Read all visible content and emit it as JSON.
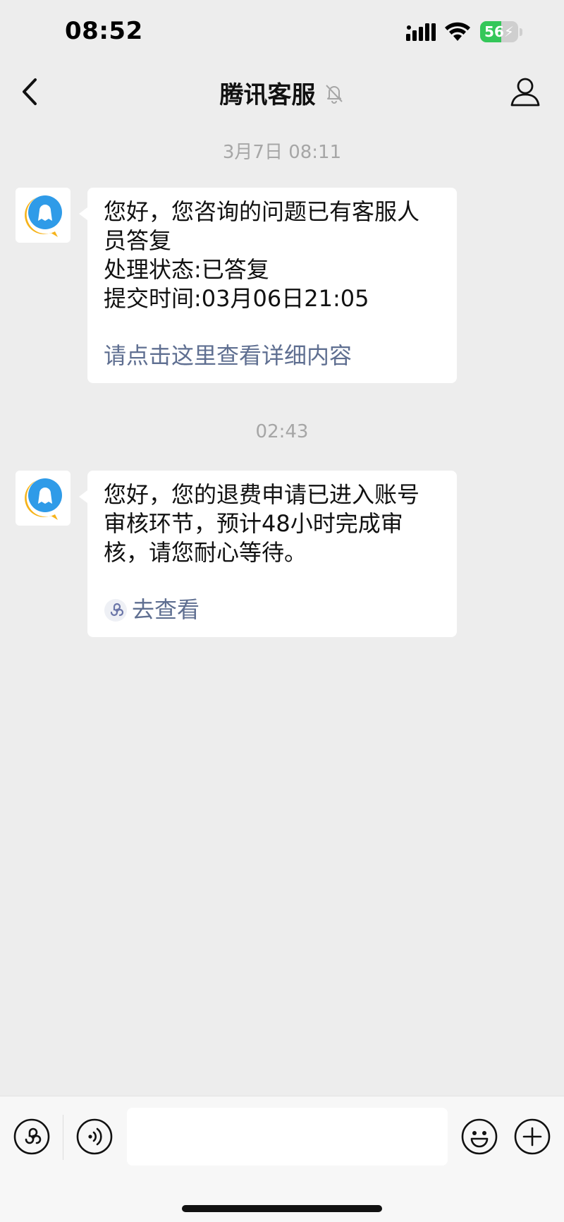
{
  "status_bar": {
    "time": "08:52",
    "battery_level": "56",
    "battery_fraction": 0.56,
    "icons": [
      "signal-icon",
      "wifi-icon",
      "battery-charging-icon"
    ]
  },
  "nav": {
    "title": "腾讯客服",
    "back_icon": "chevron-left-icon",
    "mute_icon": "bell-muted-icon",
    "profile_icon": "person-icon"
  },
  "chat": {
    "timestamp_1": "3月7日 08:11",
    "message_1": {
      "lines": [
        "您好，您咨询的问题已有客服人",
        "员答复",
        "处理状态:已答复",
        "提交时间:03月06日21:05"
      ],
      "link": "请点击这里查看详细内容"
    },
    "timestamp_2": "02:43",
    "message_2": {
      "lines": [
        "您好，您的退费申请已进入账号",
        "审核环节，预计48小时完成审",
        "核，请您耐心等待。"
      ],
      "link": "去查看",
      "link_icon": "mini-program-icon"
    }
  },
  "bottom_bar": {
    "input_value": "",
    "icons": [
      "mini-program-icon",
      "voice-icon",
      "emoji-icon",
      "plus-icon"
    ]
  },
  "colors": {
    "background": "#ededed",
    "bubble": "#ffffff",
    "link": "#5f6f91",
    "timestamp": "#a6a6a6",
    "battery_green": "#34c759",
    "avatar_blue": "#2f9be8",
    "avatar_yellow": "#f6b31a"
  }
}
